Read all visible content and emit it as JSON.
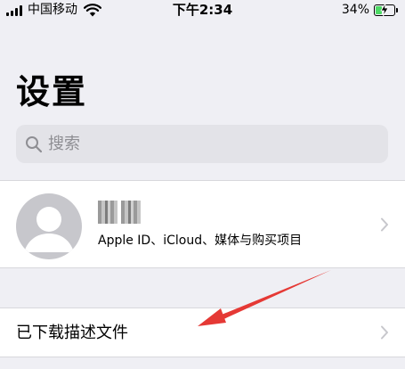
{
  "status_bar": {
    "carrier": "中国移动",
    "time": "下午2:34",
    "battery_percent": "34%",
    "battery_level": 0.34,
    "charging": true,
    "signal_bars": 4
  },
  "header": {
    "title": "设置"
  },
  "search": {
    "placeholder": "搜索",
    "icon": "search-icon"
  },
  "profile": {
    "name": "",
    "subtitle": "Apple ID、iCloud、媒体与购买项目",
    "avatar_icon": "person-silhouette-icon"
  },
  "rows": [
    {
      "label": "已下载描述文件",
      "icon": "chevron-right-icon"
    }
  ],
  "annotation": {
    "type": "arrow",
    "color": "#e53935",
    "points_to": "downloaded-profile-row"
  },
  "colors": {
    "background": "#efeff4",
    "cell": "#ffffff",
    "search_field": "#e3e3e8",
    "placeholder": "#8e8e93",
    "chevron": "#c7c7cc",
    "charging_green": "#4cd964",
    "arrow_red": "#e53935"
  }
}
